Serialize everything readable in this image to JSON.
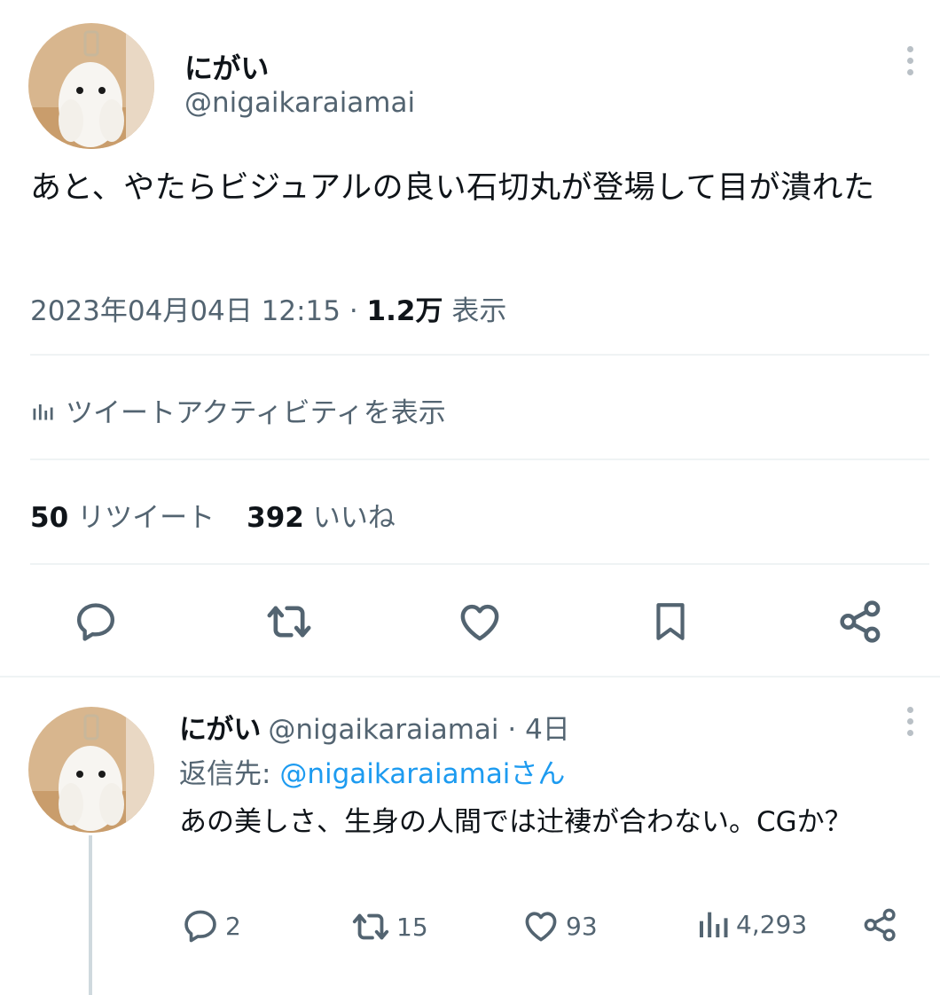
{
  "tweet": {
    "author_name": "にがい",
    "author_handle": "@nigaikaraiamai",
    "text": "あと、やたらビジュアルの良い石切丸が登場して目が潰れた",
    "datetime": "2023年04月04日 12:15",
    "separator": " · ",
    "view_count": "1.2万",
    "view_label": "表示",
    "activity_label": "ツイートアクティビティを表示",
    "retweet_count": "50",
    "retweet_label": "リツイート",
    "like_count": "392",
    "like_label": "いいね",
    "actions": [
      "reply-icon",
      "retweet-icon",
      "like-icon",
      "bookmark-icon",
      "share-icon"
    ]
  },
  "reply": {
    "author_name": "にがい",
    "author_handle": "@nigaikaraiamai",
    "time": "· 4日",
    "reply_prefix": "返信先: ",
    "reply_to": "@nigaikaraiamaiさん",
    "text": "あの美しさ、生身の人間では辻褄が合わない。CGか？",
    "reply_count": "2",
    "retweet_count": "15",
    "like_count": "93",
    "view_count": "4,293"
  },
  "colors": {
    "text": "#0f1419",
    "secondary": "#536471",
    "link": "#1d9bf0",
    "divider": "#eff3f4"
  }
}
